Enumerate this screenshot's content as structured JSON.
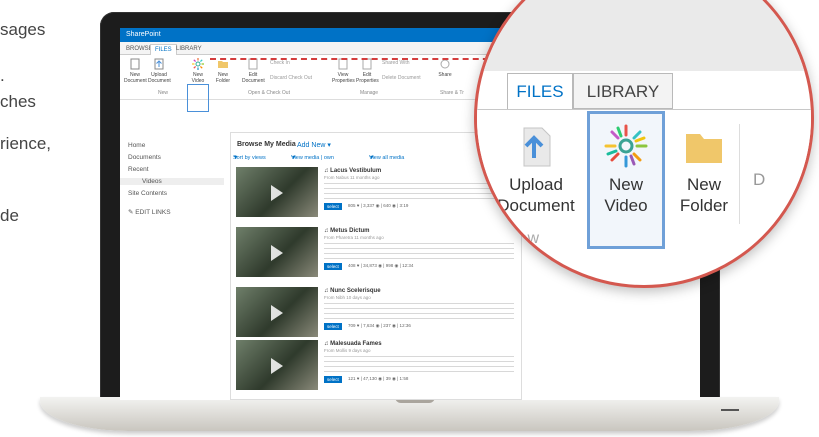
{
  "background_text": [
    "sages",
    ".",
    "ches",
    "rience,",
    "de"
  ],
  "app": {
    "title": "SharePoint"
  },
  "tabs": [
    "BROWSE",
    "FILES",
    "LIBRARY"
  ],
  "ribbon": {
    "buttons": [
      {
        "label": "New Document",
        "icon": "new-document-icon"
      },
      {
        "label": "Upload Document",
        "icon": "upload-icon"
      },
      {
        "label": "New Video",
        "icon": "new-video-icon"
      },
      {
        "label": "New Folder",
        "icon": "folder-icon"
      },
      {
        "label": "Edit Document",
        "icon": "edit-document-icon"
      },
      {
        "label": "View Properties",
        "icon": "view-properties-icon"
      },
      {
        "label": "Edit Properties",
        "icon": "edit-properties-icon"
      },
      {
        "label": "Share",
        "icon": "share-icon"
      }
    ],
    "small": [
      "Check In",
      "Discard Check Out",
      "Shared With",
      "Delete Document"
    ],
    "groups": [
      "New",
      "Open & Check Out",
      "Manage",
      "Share & Tr"
    ]
  },
  "nav": {
    "items": [
      "Home",
      "Documents",
      "Recent",
      "Videos",
      "Site Contents"
    ],
    "edit_links": "EDIT LINKS"
  },
  "panel": {
    "title": "Browse My Media",
    "add_new": "Add New",
    "filters": [
      "Sort by views",
      "View media | own",
      "View all media"
    ],
    "videos": [
      {
        "title": "Lacus Vestibulum",
        "meta": "From Nabus 11 months ago",
        "stats": "805 ♥ | 3,337 ◉ | 640 ◉ | 3:19"
      },
      {
        "title": "Metus Dictum",
        "meta": "From Pharetra 11 months ago",
        "stats": "408 ♥ | 34,873 ◉ | 998 ◉ | 12:34"
      },
      {
        "title": "Nunc Scelerisque",
        "meta": "From Nibh 10 days ago",
        "stats": "709 ♥ | 7,634 ◉ | 237 ◉ | 12:36"
      },
      {
        "title": "Malesuada Fames",
        "meta": "From Mollis 9 days ago",
        "stats": "121 ♥ | 47,130 ◉ | 39 ◉ | 1:58"
      }
    ],
    "select_label": "select"
  },
  "magnified": {
    "tabs": [
      "FILES",
      "LIBRARY"
    ],
    "buttons": [
      {
        "line1": "Upload",
        "line2": "Document",
        "icon": "upload-icon"
      },
      {
        "line1": "New",
        "line2": "Video",
        "icon": "new-video-icon"
      },
      {
        "line1": "New",
        "line2": "Folder",
        "icon": "folder-icon"
      }
    ],
    "ghost": "New",
    "cut": "D"
  },
  "colors": {
    "accent": "#0072c6",
    "highlight": "#d4584f",
    "folder": "#f0c76a"
  }
}
